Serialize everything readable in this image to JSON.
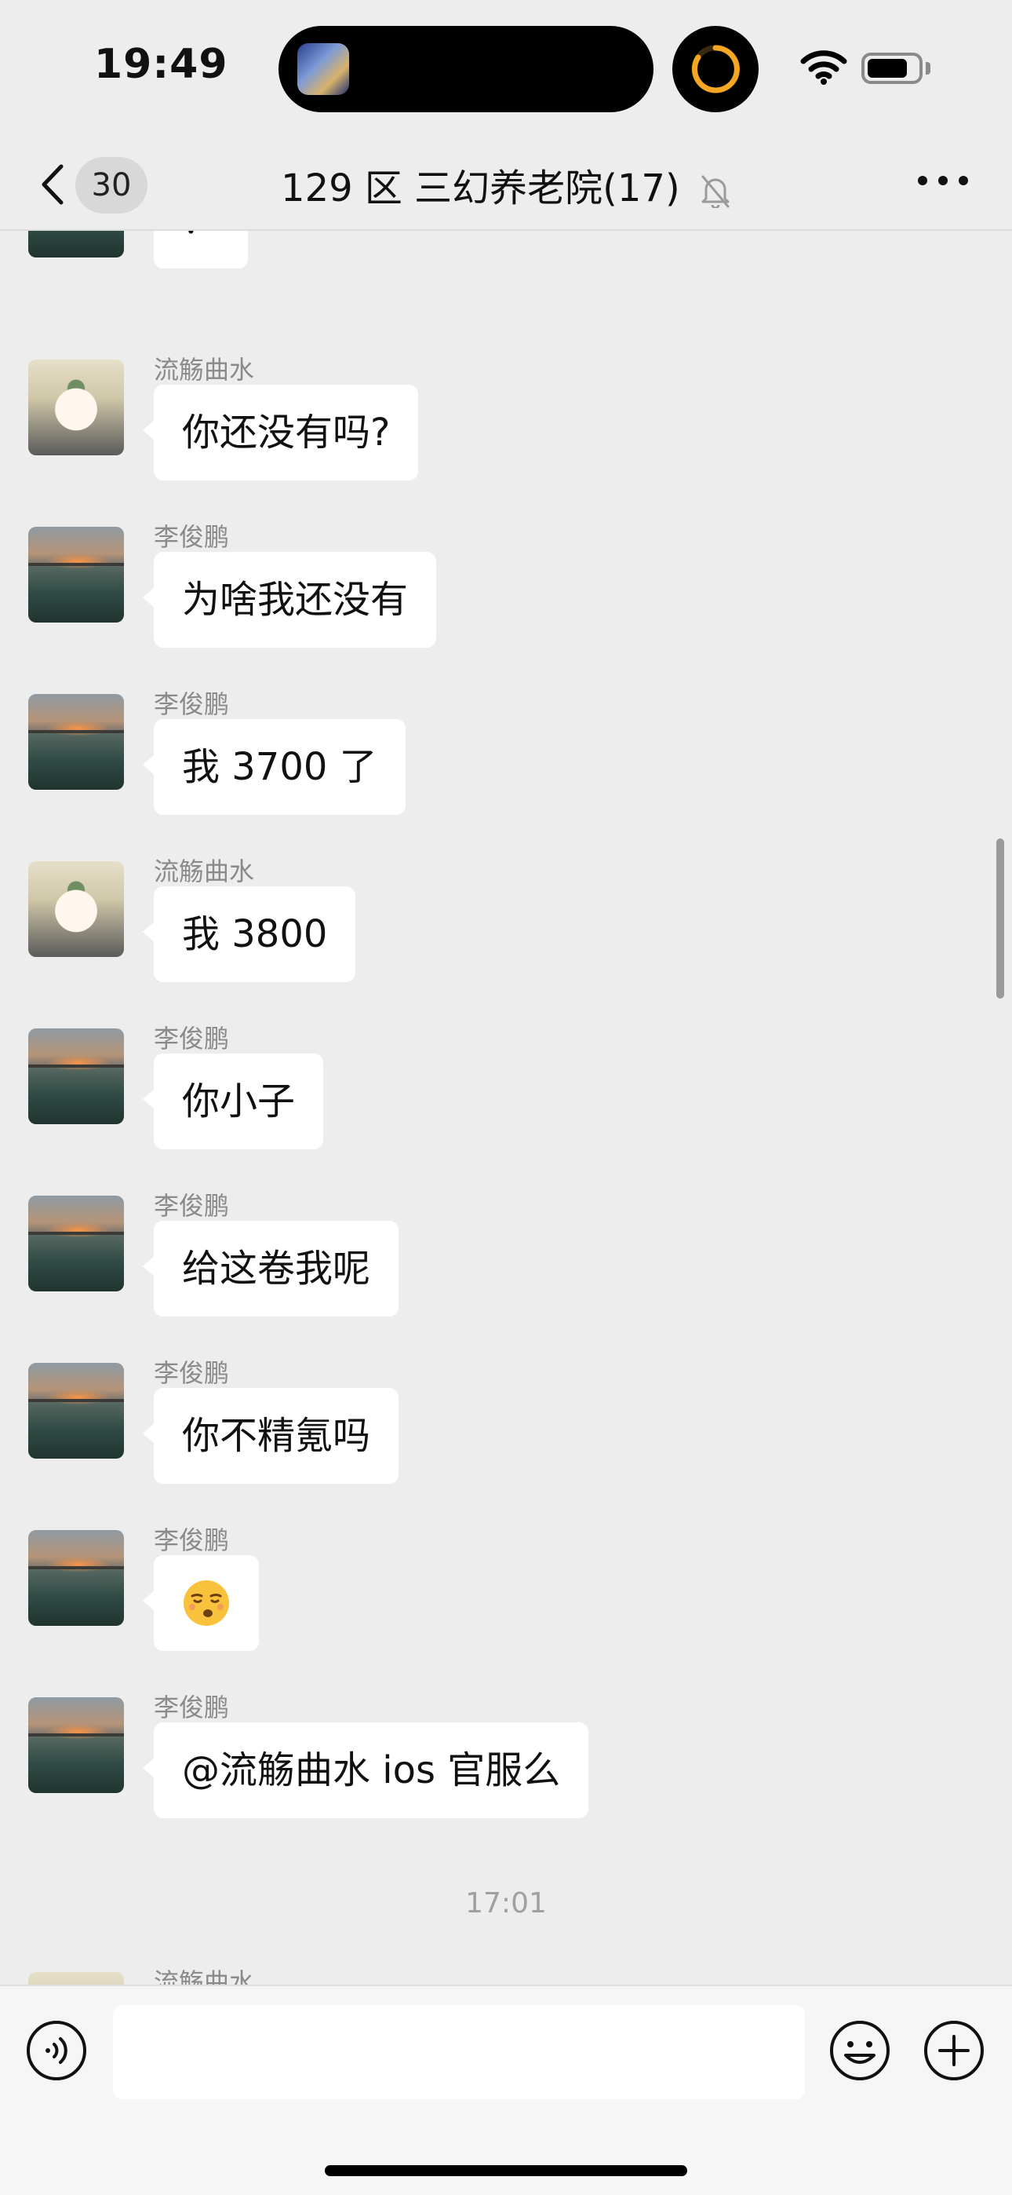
{
  "status_bar": {
    "time": "19:49",
    "icons": [
      "dynamic-island",
      "game-app-icon",
      "progress-ring-icon",
      "wifi-icon",
      "battery-icon"
    ]
  },
  "nav": {
    "unread_count": "30",
    "title": "129 区 三幻养老院(17)",
    "icons": [
      "back-chevron-icon",
      "mute-bell-icon",
      "more-dots-icon"
    ]
  },
  "messages": [
    {
      "sender": "",
      "text": "？",
      "avatar": "lake-sunset"
    },
    {
      "sender": "流觞曲水",
      "text": "你还没有吗?",
      "avatar": "anime-character"
    },
    {
      "sender": "李俊鹏",
      "text": "为啥我还没有",
      "avatar": "lake-sunset"
    },
    {
      "sender": "李俊鹏",
      "text": "我 3700 了",
      "avatar": "lake-sunset"
    },
    {
      "sender": "流觞曲水",
      "text": "我 3800",
      "avatar": "anime-character"
    },
    {
      "sender": "李俊鹏",
      "text": "你小子",
      "avatar": "lake-sunset"
    },
    {
      "sender": "李俊鹏",
      "text": "给这卷我呢",
      "avatar": "lake-sunset"
    },
    {
      "sender": "李俊鹏",
      "text": "你不精氪吗",
      "avatar": "lake-sunset"
    },
    {
      "sender": "李俊鹏",
      "text": "",
      "emoji": "smirk-face-emoji",
      "avatar": "lake-sunset"
    },
    {
      "sender": "李俊鹏",
      "text": "@流觞曲水 ios 官服么",
      "avatar": "lake-sunset"
    },
    {
      "sender": "流觞曲水",
      "text": "",
      "avatar": "anime-character"
    }
  ],
  "timestamp": "17:01",
  "input_bar": {
    "placeholder": "",
    "icons": [
      "voice-icon",
      "emoji-icon",
      "plus-icon"
    ]
  },
  "colors": {
    "background": "#ededed",
    "bubble": "#ffffff",
    "sender_text": "#8a8a8a",
    "progress_ring": "#f5a623"
  }
}
